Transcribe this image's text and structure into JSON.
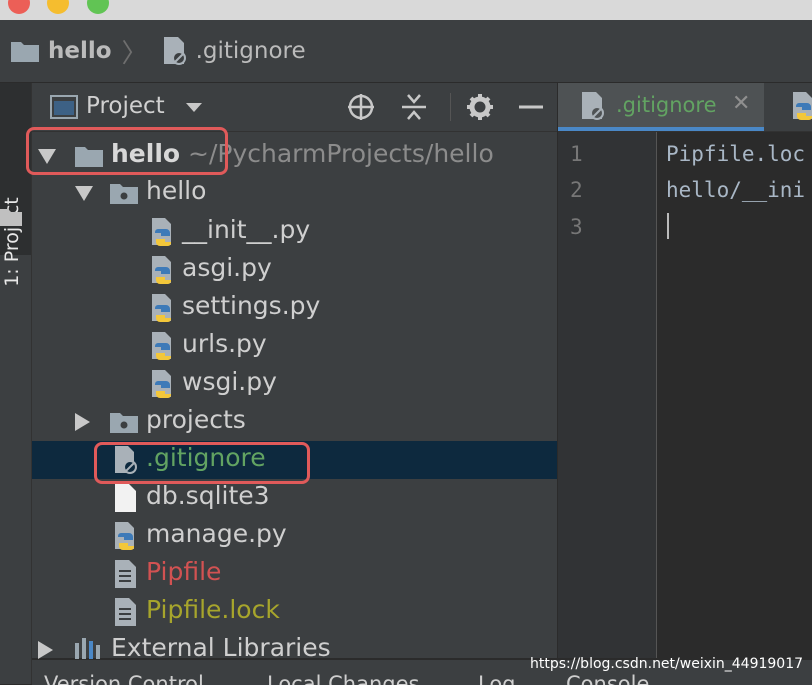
{
  "breadcrumb": {
    "root": "hello",
    "file": ".gitignore"
  },
  "tool_stripe": {
    "project_label": "1: Project"
  },
  "project_panel": {
    "title": "Project",
    "tree": [
      {
        "label": "hello",
        "path": "~/PycharmProjects/hello",
        "kind": "project-root",
        "expanded": true
      },
      {
        "label": "hello",
        "kind": "package",
        "expanded": true
      },
      {
        "label": "__init__.py",
        "kind": "python-file"
      },
      {
        "label": "asgi.py",
        "kind": "python-file"
      },
      {
        "label": "settings.py",
        "kind": "python-file"
      },
      {
        "label": "urls.py",
        "kind": "python-file"
      },
      {
        "label": "wsgi.py",
        "kind": "python-file"
      },
      {
        "label": "projects",
        "kind": "package",
        "expanded": false
      },
      {
        "label": ".gitignore",
        "kind": "ignore-file",
        "selected": true
      },
      {
        "label": "db.sqlite3",
        "kind": "file"
      },
      {
        "label": "manage.py",
        "kind": "python-file"
      },
      {
        "label": "Pipfile",
        "kind": "text-file"
      },
      {
        "label": "Pipfile.lock",
        "kind": "text-file"
      },
      {
        "label": "External Libraries",
        "kind": "libraries",
        "expanded": false
      }
    ]
  },
  "editor": {
    "tab_label": ".gitignore",
    "line_numbers": [
      "1",
      "2",
      "3"
    ],
    "lines": [
      "Pipfile.loc",
      "hello/__ini",
      ""
    ]
  },
  "bottom_bar": {
    "items": [
      "Version Control",
      "Local Changes",
      "Log",
      "Console"
    ]
  },
  "watermark": "https://blog.csdn.net/weixin_44919017",
  "colors": {
    "git_added": "#62a362",
    "git_untracked": "#d25252",
    "git_modified_yellow": "#a7a52c",
    "selection": "#0d293e",
    "highlight_box": "#e05a5a",
    "accent": "#4a88c7"
  }
}
